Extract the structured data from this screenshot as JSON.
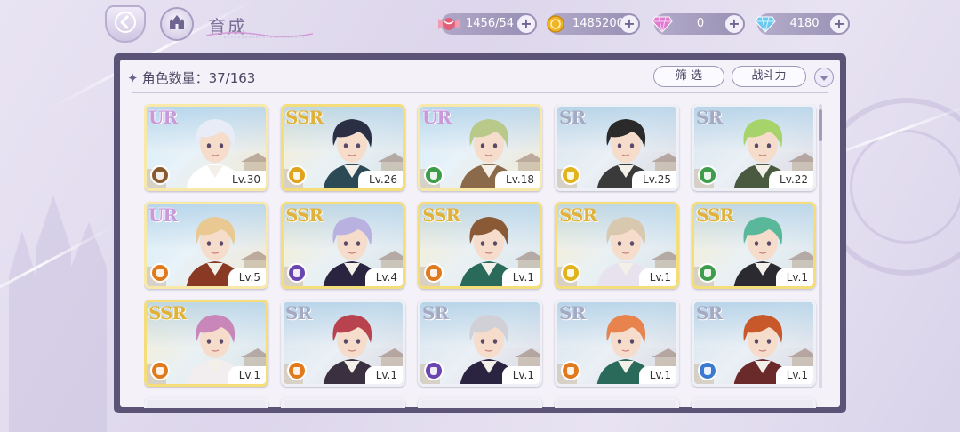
{
  "header": {
    "title": "育成"
  },
  "resources": [
    {
      "name": "stamina",
      "icon": "candy-icon",
      "value": "1456/54",
      "color": "#e0607a"
    },
    {
      "name": "gold",
      "icon": "gold-coin-icon",
      "value": "1485200",
      "color": "#f0b428"
    },
    {
      "name": "pink-gem",
      "icon": "pink-diamond-icon",
      "value": "0",
      "color": "#e07ad0"
    },
    {
      "name": "blue-gem",
      "icon": "blue-diamond-icon",
      "value": "4180",
      "color": "#6ac8f0"
    }
  ],
  "panel": {
    "count_label": "角色数量：37/163",
    "filter_label": "筛 选",
    "sort_label": "战斗力"
  },
  "cards": [
    {
      "rarity": "UR",
      "level": "Lv.30",
      "element": "#8a5a2e",
      "hair": "#e8ecf6",
      "outfit": "#ffffff"
    },
    {
      "rarity": "SSR",
      "level": "Lv.26",
      "element": "#e0a31c",
      "hair": "#2b2f45",
      "outfit": "#2b4a56"
    },
    {
      "rarity": "UR",
      "level": "Lv.18",
      "element": "#3f9c4a",
      "hair": "#b9c98a",
      "outfit": "#8a6a4a"
    },
    {
      "rarity": "SR",
      "level": "Lv.25",
      "element": "#e0b41c",
      "hair": "#2a2a2a",
      "outfit": "#3a3a3a"
    },
    {
      "rarity": "SR",
      "level": "Lv.22",
      "element": "#3f9c4a",
      "hair": "#a6d36a",
      "outfit": "#4a5a40"
    },
    {
      "rarity": "UR",
      "level": "Lv.5",
      "element": "#e07a1c",
      "hair": "#e9c892",
      "outfit": "#8a3a24"
    },
    {
      "rarity": "SSR",
      "level": "Lv.4",
      "element": "#6a45b0",
      "hair": "#b9b1e0",
      "outfit": "#2a2440"
    },
    {
      "rarity": "SSR",
      "level": "Lv.1",
      "element": "#e07a1c",
      "hair": "#8a5a36",
      "outfit": "#2a6a5a"
    },
    {
      "rarity": "SSR",
      "level": "Lv.1",
      "element": "#e0b41c",
      "hair": "#d8c8b0",
      "outfit": "#e8e2ee"
    },
    {
      "rarity": "SSR",
      "level": "Lv.1",
      "element": "#3f9c4a",
      "hair": "#5ab89a",
      "outfit": "#2a2a30"
    },
    {
      "rarity": "SSR",
      "level": "Lv.1",
      "element": "#e07a1c",
      "hair": "#c986b8",
      "outfit": "#f2eef0"
    },
    {
      "rarity": "SR",
      "level": "Lv.1",
      "element": "#e07a1c",
      "hair": "#b8424e",
      "outfit": "#3a3040"
    },
    {
      "rarity": "SR",
      "level": "Lv.1",
      "element": "#6a45b0",
      "hair": "#d0d0d6",
      "outfit": "#2a2440"
    },
    {
      "rarity": "SR",
      "level": "Lv.1",
      "element": "#e07a1c",
      "hair": "#e8834e",
      "outfit": "#2a6a5a"
    },
    {
      "rarity": "SR",
      "level": "Lv.1",
      "element": "#3a7ad0",
      "hair": "#c8582a",
      "outfit": "#6a2a2a"
    }
  ]
}
